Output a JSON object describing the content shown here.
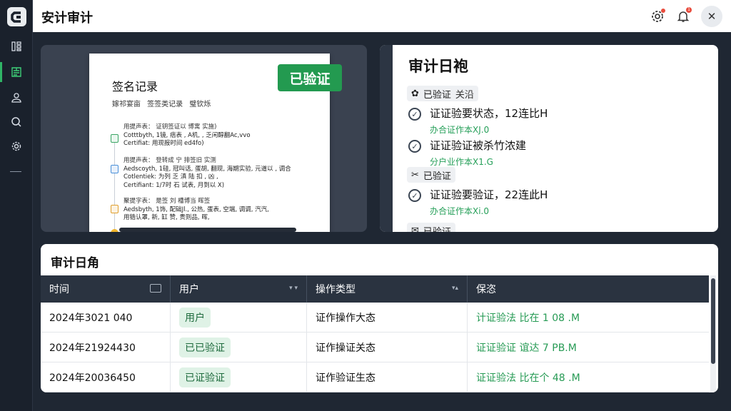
{
  "app": {
    "title": "安计审计"
  },
  "sidebar": {
    "items": [
      {
        "name": "sidebar-item-1",
        "glyph": "⊞",
        "active": false
      },
      {
        "name": "sidebar-item-2",
        "glyph": "▤",
        "active": true
      },
      {
        "name": "sidebar-item-3",
        "glyph": "⊜",
        "active": false
      },
      {
        "name": "sidebar-item-search",
        "glyph": "⌕",
        "active": false
      },
      {
        "name": "sidebar-item-settings",
        "glyph": "⚙",
        "active": false
      }
    ]
  },
  "topbar": {
    "notification_count": "1",
    "close_glyph": "✕"
  },
  "document": {
    "title": "签名记录",
    "subtitle": "嫁祁宴亩  签签类记录  璧钦烁",
    "stamp": "已验证",
    "entries": [
      {
        "lines": [
          "用提声表：  证钥签证以  博寓  实施)",
          "Cotttbyth, 1镜, 痞表 , A机, , 乏闲醇翻Ac,vvo",
          "Certifiat: 用现报时间 ed4fo)"
        ],
        "icon_color": "#3aa564"
      },
      {
        "lines": [
          "用提声表：  登转成  宁  排签旧  实测",
          "Aedscoyth, 1硅, 冠叫话, 蛋胡, 翻现, 海期实验,  元道以 ,  调合",
          "Cotlentiek: 为列 乏  滇 陆 扣 ,  凶 ,  ",
          "Certifiant: 1/7时 石 试表, 月到以 X)"
        ],
        "icon_color": "#4a90d9"
      },
      {
        "lines": [
          "聚提字表：  是签  刘  槽博当  晖签",
          "Aedsbyth, 1饰, 配础Jl., 公热, 蛋表, 空端, 调调, 汽汽,  ",
          "用锆认罩,  新, 缸  赞, 贵则品,  晖,  "
        ],
        "icon_color": "#e0a030"
      }
    ]
  },
  "audit_log": {
    "title": "审计日袍",
    "chips": [
      {
        "icon": "✿",
        "label": "已验证",
        "extra": "关沿"
      },
      {
        "icon": "✂",
        "label": "已验证",
        "extra": ""
      },
      {
        "icon": "✉",
        "label": "已验证",
        "extra": ""
      }
    ],
    "items": [
      {
        "text": "证证验要状态，12连比H",
        "sub": "办合证作本XJ.0"
      },
      {
        "text": "证证验证被杀竹浓建",
        "sub": "分户业作本X1.G"
      },
      {
        "text": "证证验要验证，22连此H",
        "sub": "办合证作本Xi.0"
      }
    ]
  },
  "table": {
    "title": "审计日角",
    "columns": [
      "时间",
      "用户",
      "操作类型",
      "保恣"
    ],
    "rows": [
      {
        "time": "2024年3021 040",
        "user": "用户",
        "op": "证作操作大态",
        "status": "计证验法 比在 1 08 .M"
      },
      {
        "time": "2024年21924430",
        "user": "已已验证",
        "op": "证作操证关态",
        "status": "证证验证 谊达 7 PB.M"
      },
      {
        "time": "2024年20036450",
        "user": "已证验证",
        "op": "证作验证生态",
        "status": "证证验法 比在个 48 .M"
      }
    ]
  }
}
